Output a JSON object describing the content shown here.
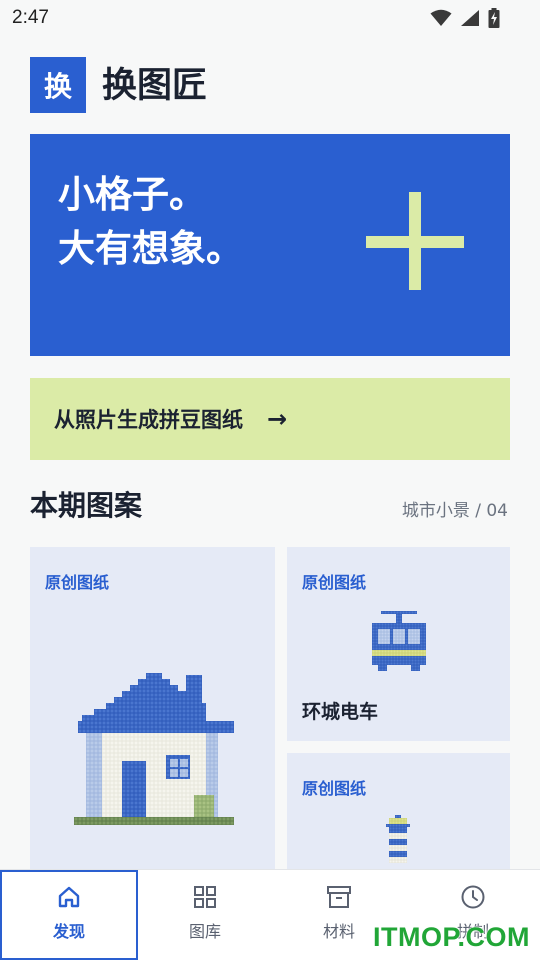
{
  "status_bar": {
    "time": "2:47",
    "icons": [
      "wifi-icon",
      "signal-icon",
      "battery-charging-icon"
    ]
  },
  "header": {
    "logo_char": "换",
    "app_title": "换图匠"
  },
  "hero": {
    "line1": "小格子。",
    "line2": "大有想象。",
    "icon": "plus-icon"
  },
  "cta": {
    "label": "从照片生成拼豆图纸",
    "arrow": "→"
  },
  "section": {
    "title": "本期图案",
    "meta": "城市小景 / 04"
  },
  "cards": [
    {
      "badge": "原创图纸",
      "name": "",
      "icon": "house-pixel-art"
    },
    {
      "badge": "原创图纸",
      "name": "环城电车",
      "icon": "tram-pixel-art"
    },
    {
      "badge": "原创图纸",
      "name": "",
      "icon": "lighthouse-pixel-art"
    }
  ],
  "nav": [
    {
      "label": "发现",
      "icon": "home-icon",
      "active": true
    },
    {
      "label": "图库",
      "icon": "grid-icon",
      "active": false
    },
    {
      "label": "材料",
      "icon": "archive-box-icon",
      "active": false
    },
    {
      "label": "拼制",
      "icon": "clock-icon",
      "active": false
    }
  ],
  "watermark": "ITMOP.COM",
  "colors": {
    "brand_blue": "#2a5fd0",
    "accent_green": "#dbeba7",
    "card_bg": "#e5eaf6",
    "page_bg": "#f7f8f8"
  }
}
